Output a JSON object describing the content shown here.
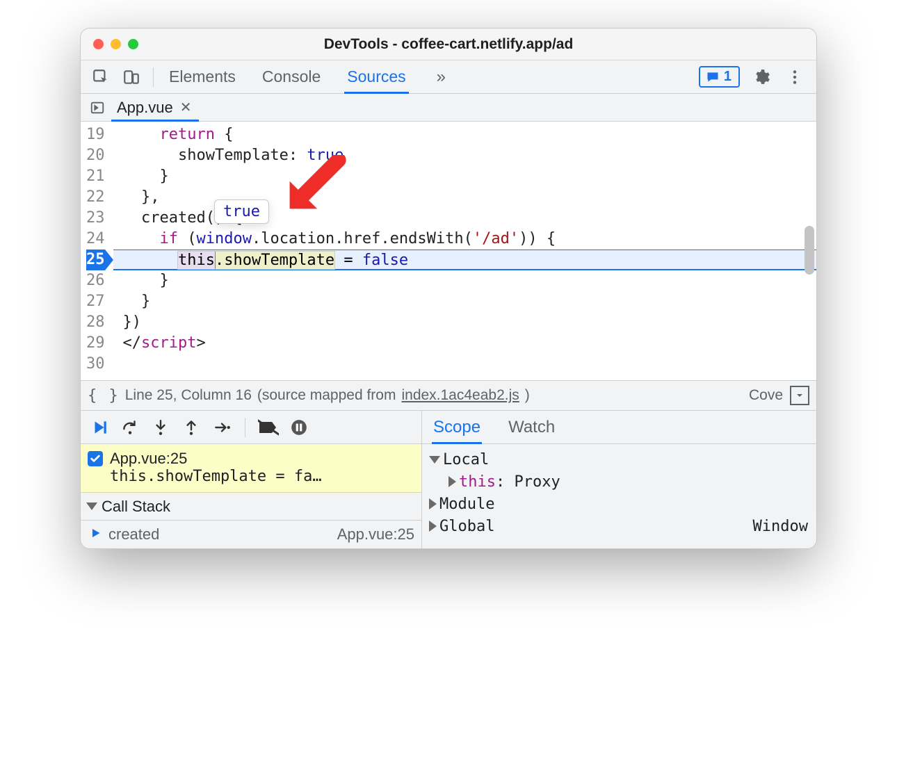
{
  "window": {
    "title": "DevTools - coffee-cart.netlify.app/ad"
  },
  "main_tabs": {
    "items": [
      "Elements",
      "Console",
      "Sources"
    ],
    "active_index": 2,
    "overflow_glyph": "»",
    "issues_count": "1"
  },
  "file_tabs": {
    "items": [
      {
        "label": "App.vue"
      }
    ],
    "active_index": 0
  },
  "editor": {
    "first_line": 19,
    "execution_line": 25,
    "lines": [
      {
        "n": 19,
        "indent": "    ",
        "segments": [
          {
            "t": "return",
            "c": "kw"
          },
          {
            "t": " {",
            "c": "txt"
          }
        ]
      },
      {
        "n": 20,
        "indent": "      ",
        "segments": [
          {
            "t": "showTemplate: ",
            "c": "txt"
          },
          {
            "t": "true",
            "c": "lit"
          }
        ]
      },
      {
        "n": 21,
        "indent": "    ",
        "segments": [
          {
            "t": "}",
            "c": "txt"
          }
        ]
      },
      {
        "n": 22,
        "indent": "  ",
        "segments": [
          {
            "t": "},",
            "c": "txt"
          }
        ]
      },
      {
        "n": 23,
        "indent": "  ",
        "segments": [
          {
            "t": "created() {",
            "c": "txt"
          }
        ]
      },
      {
        "n": 24,
        "indent": "    ",
        "segments": [
          {
            "t": "if",
            "c": "kw"
          },
          {
            "t": " (",
            "c": "txt"
          },
          {
            "t": "window",
            "c": "lit"
          },
          {
            "t": ".location.href.endsWith(",
            "c": "txt"
          },
          {
            "t": "'/ad'",
            "c": "str"
          },
          {
            "t": ")) {",
            "c": "txt"
          }
        ]
      },
      {
        "n": 25,
        "indent": "      ",
        "exec": true,
        "segments": "special-25"
      },
      {
        "n": 26,
        "indent": "    ",
        "segments": [
          {
            "t": "}",
            "c": "txt"
          }
        ]
      },
      {
        "n": 27,
        "indent": "  ",
        "segments": [
          {
            "t": "}",
            "c": "txt"
          }
        ]
      },
      {
        "n": 28,
        "indent": "",
        "segments": [
          {
            "t": "})",
            "c": "txt"
          }
        ]
      },
      {
        "n": 29,
        "indent": "",
        "segments": [
          {
            "t": "</",
            "c": "txt"
          },
          {
            "t": "script",
            "c": "tag"
          },
          {
            "t": ">",
            "c": "txt"
          }
        ]
      },
      {
        "n": 30,
        "indent": "",
        "segments": []
      }
    ],
    "exec_parts": {
      "this": "this",
      "prop": ".showTemplate",
      "assign": " = ",
      "value": "false"
    },
    "hover_value": "true"
  },
  "status": {
    "line_col": "Line 25, Column 16",
    "mapped_prefix": "(source mapped from ",
    "mapped_file": "index.1ac4eab2.js",
    "mapped_suffix": ")",
    "coverage_label": "Cove"
  },
  "breakpoint": {
    "checked": true,
    "location": "App.vue:25",
    "preview": "this.showTemplate = fa…"
  },
  "callstack": {
    "header": "Call Stack",
    "top_frame": "created",
    "top_frame_loc": "App.vue:25"
  },
  "scope": {
    "tabs": [
      "Scope",
      "Watch"
    ],
    "active_index": 0,
    "local_label": "Local",
    "this_label": "this",
    "this_value": "Proxy",
    "module_label": "Module",
    "global_label": "Global",
    "global_value": "Window"
  }
}
